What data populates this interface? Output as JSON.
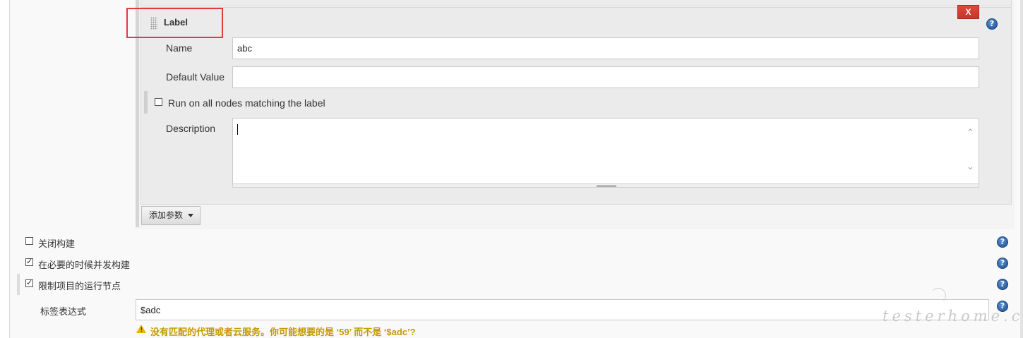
{
  "parameter": {
    "title": "Label",
    "delete_label": "X",
    "help_glyph": "?",
    "fields": {
      "name_label": "Name",
      "name_value": "abc",
      "default_label": "Default Value",
      "default_value": "",
      "run_all_label": "Run on all nodes matching the label",
      "run_all_checked": false,
      "description_label": "Description",
      "description_value": ""
    },
    "add_button_label": "添加参数"
  },
  "options": [
    {
      "label": "关闭构建",
      "checked": false
    },
    {
      "label": "在必要的时候并发构建",
      "checked": true
    },
    {
      "label": "限制项目的运行节点",
      "checked": true
    }
  ],
  "label_expression": {
    "label": "标签表达式",
    "value": "$adc"
  },
  "warning": {
    "text": "没有匹配的代理或者云服务。你可能想要的是 ‘59’ 而不是 ‘$adc’?",
    "color": "#c49a00"
  },
  "watermark": "testerhome.com",
  "colors": {
    "delete_button": "#d0392e",
    "highlight_border": "#e03c3c",
    "help_icon": "#1c4f93"
  }
}
